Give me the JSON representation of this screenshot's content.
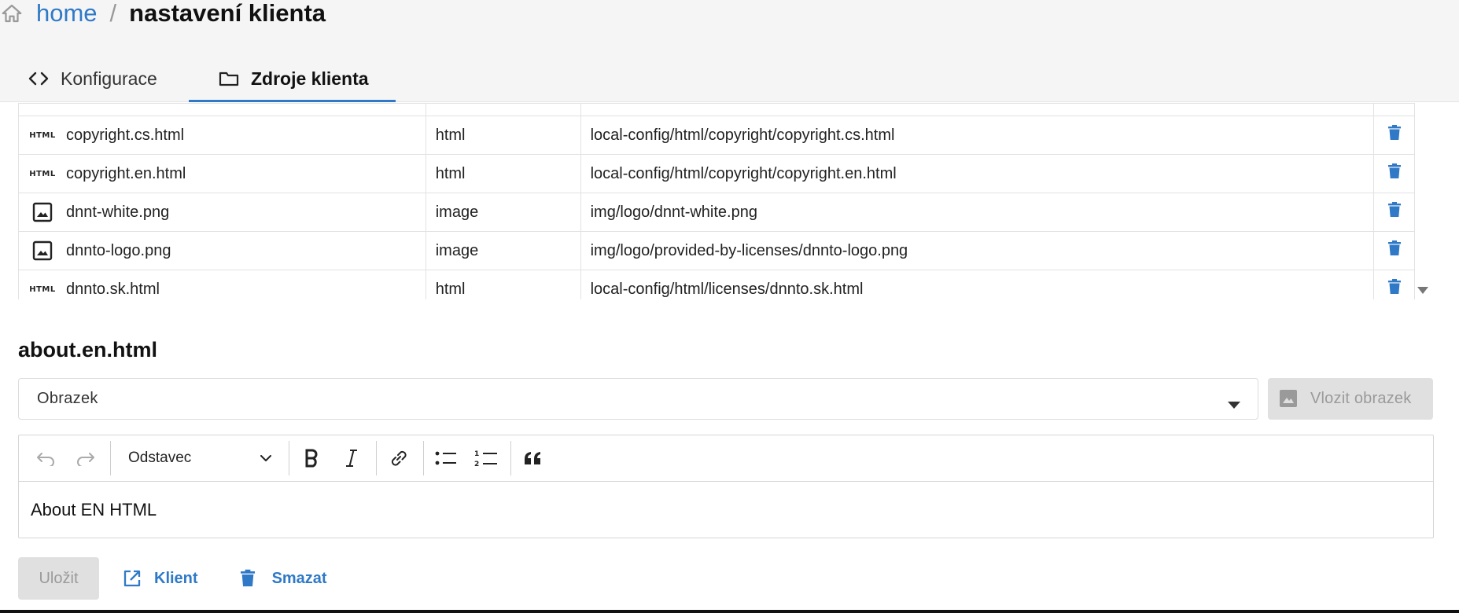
{
  "breadcrumb": {
    "home": "home",
    "separator": "/",
    "current": "nastavení klienta"
  },
  "tabs": [
    {
      "label": "Konfigurace",
      "icon": "code-icon",
      "active": false
    },
    {
      "label": "Zdroje klienta",
      "icon": "folder-icon",
      "active": true
    }
  ],
  "files": [
    {
      "name": "copyright.cs.html",
      "type": "html",
      "path": "local-config/html/copyright/copyright.cs.html",
      "icon": "html-icon"
    },
    {
      "name": "copyright.en.html",
      "type": "html",
      "path": "local-config/html/copyright/copyright.en.html",
      "icon": "html-icon"
    },
    {
      "name": "dnnt-white.png",
      "type": "image",
      "path": "img/logo/dnnt-white.png",
      "icon": "image-icon"
    },
    {
      "name": "dnnto-logo.png",
      "type": "image",
      "path": "img/logo/provided-by-licenses/dnnto-logo.png",
      "icon": "image-icon"
    },
    {
      "name": "dnnto.sk.html",
      "type": "html",
      "path": "local-config/html/licenses/dnnto.sk.html",
      "icon": "html-icon"
    }
  ],
  "html_tag": "HTML",
  "selected_file": "about.en.html",
  "image_select": {
    "value": "Obrazek"
  },
  "insert_image_label": "Vlozit obrazek",
  "editor": {
    "paragraph_style": "Odstavec",
    "content": "About EN HTML"
  },
  "actions": {
    "save": "Uložit",
    "client": "Klient",
    "delete": "Smazat"
  },
  "colors": {
    "accent": "#2f79c7",
    "disabled_bg": "#e0e0e0",
    "disabled_text": "#9a9a9a",
    "header_bg": "#f5f5f5"
  }
}
